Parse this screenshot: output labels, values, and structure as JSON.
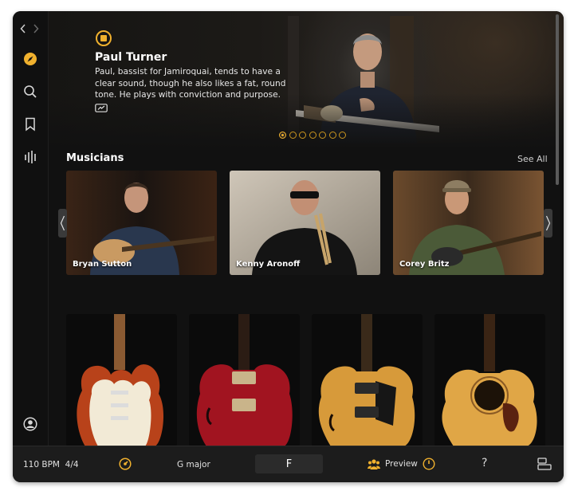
{
  "hero": {
    "title": "Paul Turner",
    "description": "Paul, bassist for Jamiroquai, tends to have a clear sound, though he also likes a fat, round tone. He plays with conviction and purpose.",
    "slide_count": 7,
    "active_slide": 1,
    "accent_color": "#f0b12e"
  },
  "sidebar": {
    "icons": [
      "back-icon",
      "forward-icon",
      "compass-icon",
      "search-icon",
      "bookmark-icon",
      "equalizer-icon",
      "account-icon"
    ]
  },
  "musicians": {
    "section_title": "Musicians",
    "see_all": "See All",
    "cards": [
      {
        "name": "Bryan Sutton"
      },
      {
        "name": "Kenny Aronoff"
      },
      {
        "name": "Corey Britz"
      }
    ]
  },
  "guitars": {
    "items": [
      "sunburst-stratocaster",
      "red-semi-hollow",
      "natural-archtop",
      "acoustic-dreadnought"
    ]
  },
  "bottom_bar": {
    "bpm": "110 BPM",
    "time_signature": "4/4",
    "key": "G major",
    "chord": "F",
    "preview_label": "Preview",
    "help": "?"
  }
}
